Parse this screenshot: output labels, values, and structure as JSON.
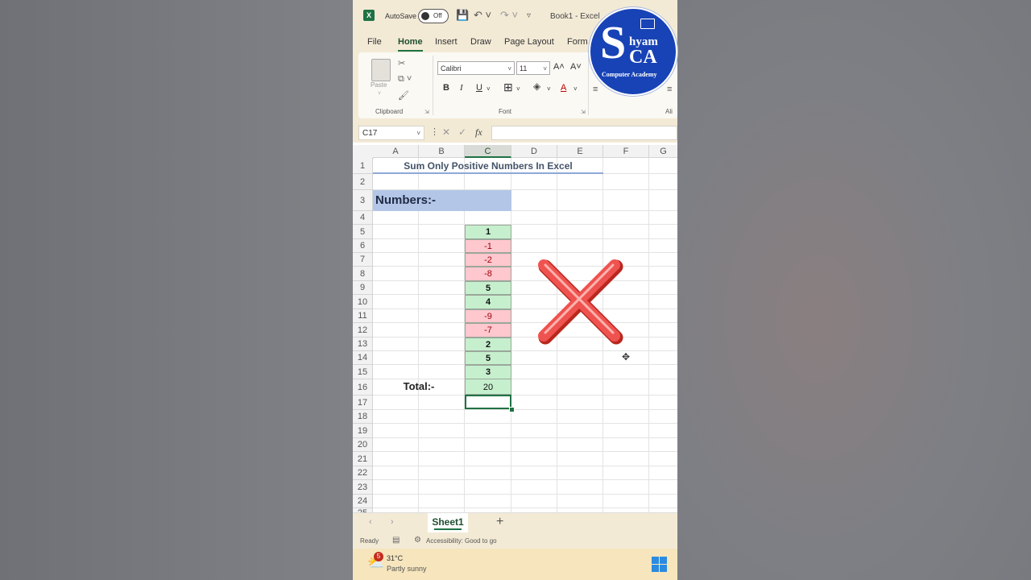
{
  "titlebar": {
    "app_icon": "X",
    "autosave_label": "AutoSave",
    "autosave_state": "Off",
    "icons": {
      "save": "save-icon",
      "undo": "undo-icon",
      "redo": "redo-icon",
      "more": "customize-quick-access-icon"
    },
    "book_title": "Book1 - Excel"
  },
  "tabs": [
    "File",
    "Home",
    "Insert",
    "Draw",
    "Page Layout",
    "Form"
  ],
  "ribbon": {
    "paste_label": "Paste",
    "clipboard_label": "Clipboard",
    "font_name": "Calibri",
    "font_size": "11",
    "font_group_label": "Font",
    "bold": "B",
    "italic": "I",
    "underline": "U",
    "grow_font": "A˄",
    "shrink_font": "A˅",
    "font_color": "A",
    "alignment_label": "Ali"
  },
  "formula_bar": {
    "name_box": "C17",
    "fx_label": "fx",
    "formula": ""
  },
  "grid": {
    "columns": [
      "A",
      "B",
      "C",
      "D",
      "E",
      "F",
      "G"
    ],
    "selected_column": "C",
    "rows": [
      "1",
      "2",
      "3",
      "4",
      "5",
      "6",
      "7",
      "8",
      "9",
      "10",
      "11",
      "12",
      "13",
      "14",
      "15",
      "16",
      "17",
      "18",
      "19",
      "20",
      "21",
      "22",
      "23",
      "24",
      "25"
    ],
    "title": "Sum Only Positive Numbers In Excel",
    "numbers_header": "Numbers:-",
    "numbers": [
      "1",
      "-1",
      "-2",
      "-8",
      "5",
      "4",
      "-9",
      "-7",
      "2",
      "5",
      "3"
    ],
    "total_label": "Total:-",
    "total_value": "20",
    "active_cell": "C17",
    "overlay": "wrong-cross-mark",
    "colors": {
      "positive_fill": "#c6efce",
      "negative_fill": "#ffc7ce",
      "negative_text": "#9c0006",
      "header_fill": "#b4c6e7",
      "cross": "#e53935"
    }
  },
  "sheet_tabs": {
    "prev": "‹",
    "next": "›",
    "sheets": [
      "Sheet1"
    ],
    "add": "+"
  },
  "status_bar": {
    "ready": "Ready",
    "accessibility": "Accessibility: Good to go"
  },
  "taskbar": {
    "weather_badge": "5",
    "temperature": "31°C",
    "weather": "Partly sunny"
  },
  "logo": {
    "letter": "S",
    "name": "hyam",
    "initials": "CA",
    "subtitle": "Computer Academy"
  }
}
